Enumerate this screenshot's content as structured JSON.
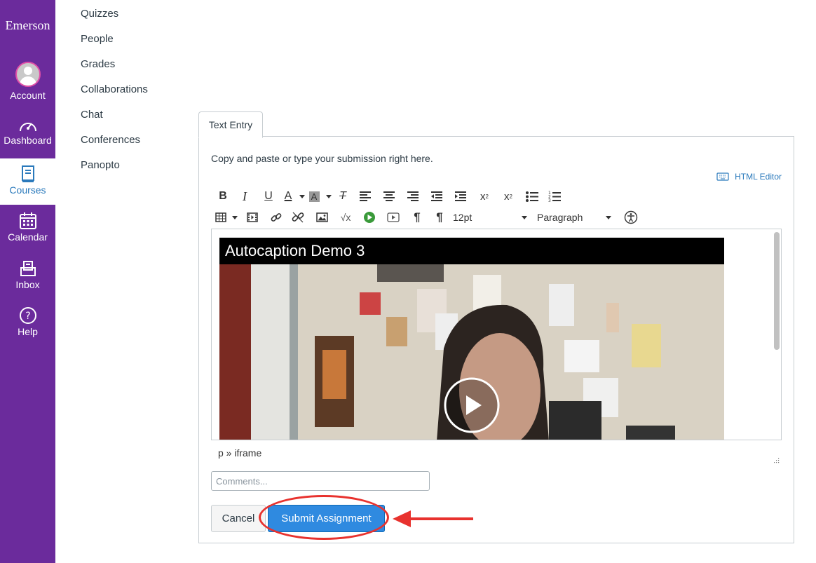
{
  "global_nav": {
    "brand": "Emerson",
    "items": [
      {
        "label": "Account",
        "icon": "avatar-icon"
      },
      {
        "label": "Dashboard",
        "icon": "speedometer-icon"
      },
      {
        "label": "Courses",
        "icon": "book-icon",
        "active": true
      },
      {
        "label": "Calendar",
        "icon": "calendar-icon"
      },
      {
        "label": "Inbox",
        "icon": "inbox-icon"
      },
      {
        "label": "Help",
        "icon": "help-icon"
      }
    ],
    "colors": {
      "background": "#6b2b9c",
      "active_text": "#2b7abc"
    }
  },
  "course_nav": {
    "items": [
      "Quizzes",
      "People",
      "Grades",
      "Collaborations",
      "Chat",
      "Conferences",
      "Panopto"
    ]
  },
  "submission": {
    "tab_label": "Text Entry",
    "instructions": "Copy and paste or type your submission right here.",
    "html_editor_label": "HTML Editor",
    "editor": {
      "font_size": "12pt",
      "block_format": "Paragraph",
      "video_title": "Autocaption Demo 3",
      "path": "p » iframe"
    },
    "comments_placeholder": "Comments...",
    "cancel_label": "Cancel",
    "submit_label": "Submit Assignment"
  },
  "colors": {
    "submit_button": "#2f8ae0",
    "annotation": "#e8322e",
    "link": "#2b7abc"
  }
}
